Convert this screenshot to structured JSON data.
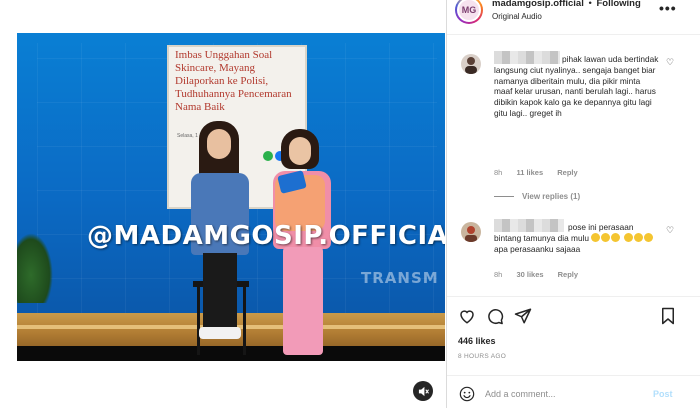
{
  "post": {
    "watermark": "@MADAMGOSIP.OFFICIAL",
    "tv_logo": "TRANSM",
    "headline": "Imbas Unggahan Soal Skincare, Mayang Dilaporkan ke Polisi, Tudhuhannya Pencemaran Nama Baik",
    "headline_meta": "Selasa, 1   19 WIB",
    "mute_icon": "speaker-muted-icon"
  },
  "header": {
    "username": "madamgosip.official",
    "separator": "•",
    "follow_label": "Following",
    "audio": "Original Audio",
    "more_label": "•••",
    "avatar_text": "MG"
  },
  "comments": [
    {
      "text": "pihak lawan uda bertindak langsung ciut nyalinya.. sengaja banget biar namanya diberitain mulu, dia pikir minta maaf kelar urusan, nanti berulah lagi.. harus dibikin kapok kalo ga ke depannya gitu lagi gitu lagi.. greget ih",
      "time": "8h",
      "likes": "11 likes",
      "reply": "Reply",
      "view_replies": "View replies (1)"
    },
    {
      "text_a": "pose ini perasaan bintang tamunya dia mulu",
      "text_b": "apa perasaanku sajaaa",
      "time": "8h",
      "likes": "30 likes",
      "reply": "Reply"
    }
  ],
  "actions": {
    "likes": "446 likes",
    "time_ago": "8 HOURS AGO"
  },
  "add_comment": {
    "placeholder": "Add a comment...",
    "post_label": "Post"
  },
  "colors": {
    "link_disabled": "#b2dffc",
    "muted_text": "#8e8e8e",
    "stage_blue": "#0a7fd4"
  }
}
